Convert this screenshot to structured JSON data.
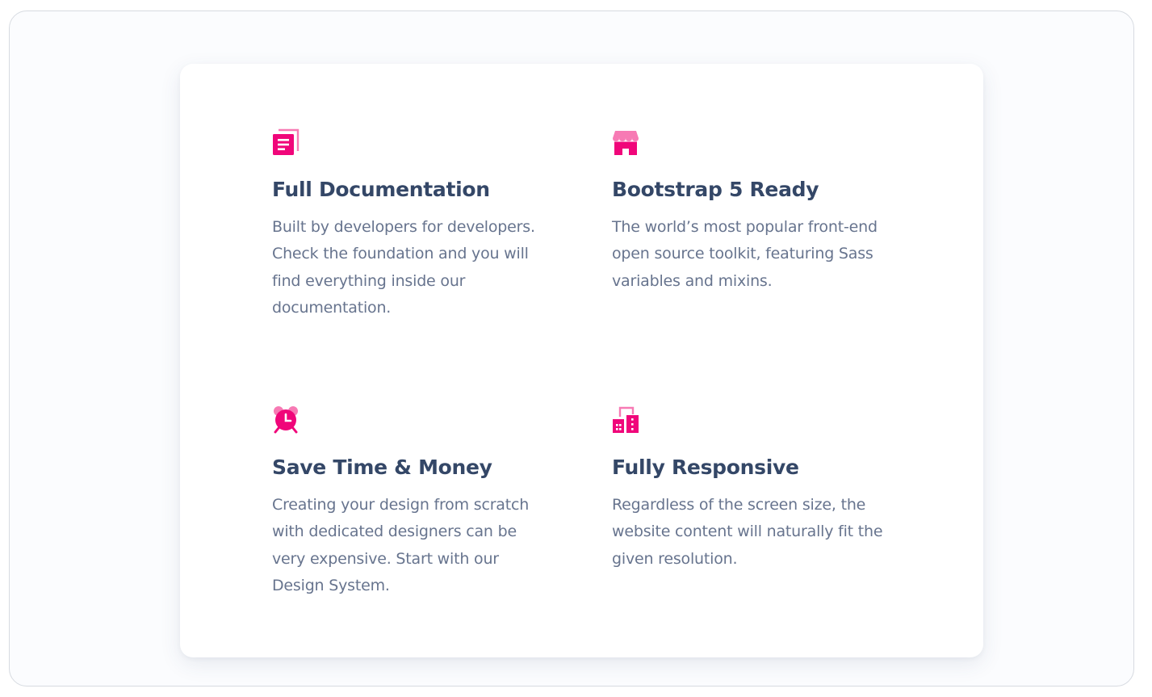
{
  "colors": {
    "accent": "#f0067a",
    "accent_light": "#f77ab4",
    "heading": "#344767",
    "body_text": "#67748e"
  },
  "features": [
    {
      "icon": "document-icon",
      "title": "Full Documentation",
      "description": "Built by developers for developers. Check the foundation and you will find everything inside our documentation."
    },
    {
      "icon": "shop-icon",
      "title": "Bootstrap 5 Ready",
      "description": "The world’s most popular front-end open source toolkit, featuring Sass variables and mixins."
    },
    {
      "icon": "alarm-clock-icon",
      "title": "Save Time & Money",
      "description": "Creating your design from scratch with dedicated designers can be very expensive. Start with our Design System."
    },
    {
      "icon": "buildings-icon",
      "title": "Fully Responsive",
      "description": "Regardless of the screen size, the website content will naturally fit the given resolution."
    }
  ]
}
